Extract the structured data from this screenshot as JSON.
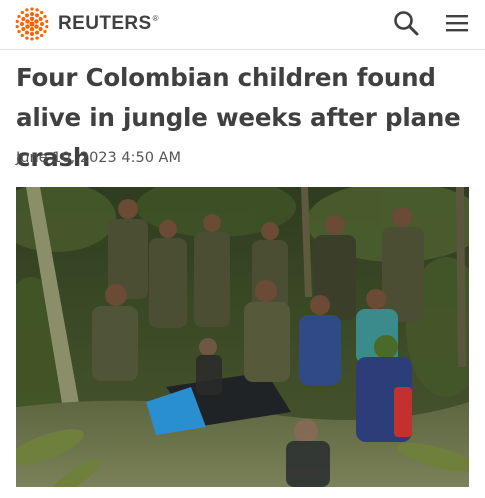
{
  "header": {
    "brand_name": "REUTERS",
    "brand_reg_mark": "®",
    "icons": {
      "logo": "reuters-dot-logo",
      "search": "search-icon",
      "menu": "hamburger-menu-icon"
    },
    "brand_color": "#fa6400"
  },
  "article": {
    "headline": "Four Colombian children found alive in jungle weeks after plane crash",
    "dateline": "June 10, 2023 4:50 AM"
  },
  "colors": {
    "text_primary": "#404040",
    "text_secondary": "#555555",
    "divider": "#e6e6e6"
  }
}
